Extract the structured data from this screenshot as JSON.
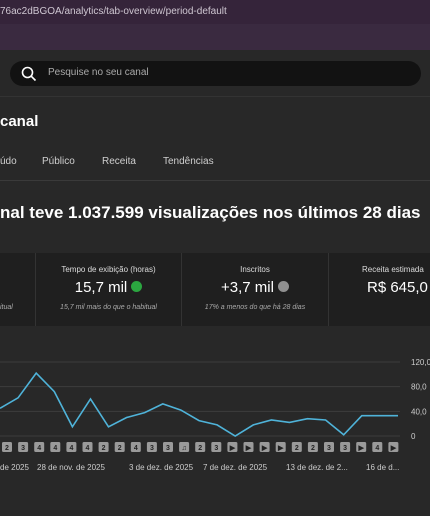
{
  "browser": {
    "url": "76ac2dBGOA/analytics/tab-overview/period-default"
  },
  "search": {
    "placeholder": "Pesquise no seu canal"
  },
  "page": {
    "title": "canal"
  },
  "tabs": [
    {
      "label": "údo"
    },
    {
      "label": "Público"
    },
    {
      "label": "Receita"
    },
    {
      "label": "Tendências"
    }
  ],
  "headline": "nal teve 1.037.599 visualizações nos últimos 28 dias",
  "cards": [
    {
      "label": "",
      "value": "",
      "sub": "itual"
    },
    {
      "label": "Tempo de exibição (horas)",
      "value": "15,7 mil",
      "trend": "up",
      "sub": "15,7 mil mais do que o habitual"
    },
    {
      "label": "Inscritos",
      "value": "+3,7 mil",
      "trend": "down",
      "sub": "17% a menos do que há 28 dias"
    },
    {
      "label": "Receita estimada",
      "value": "R$ 645,0",
      "sub": ""
    }
  ],
  "chart_data": {
    "type": "line",
    "yticks": [
      "120,0",
      "80,0",
      "40,0",
      "0"
    ],
    "ylim": [
      0,
      120
    ],
    "series": [
      {
        "values": [
          45,
          62,
          102,
          72,
          15,
          60,
          15,
          30,
          38,
          52,
          42,
          25,
          18,
          0,
          18,
          26,
          22,
          28,
          26,
          2,
          33,
          33,
          33
        ]
      }
    ],
    "xlabels": [
      "de 2025",
      "28 de nov. de 2025",
      "3 de dez. de 2025",
      "7 de dez. de 2025",
      "13 de dez. de 2...",
      "16 de d..."
    ],
    "markers": [
      "2",
      "3",
      "4",
      "4",
      "4",
      "4",
      "2",
      "2",
      "4",
      "3",
      "3",
      "b",
      "2",
      "3",
      "p",
      "p",
      "p",
      "p",
      "2",
      "2",
      "3",
      "3",
      "p",
      "4",
      "p"
    ],
    "color": "#4fb3d9"
  }
}
